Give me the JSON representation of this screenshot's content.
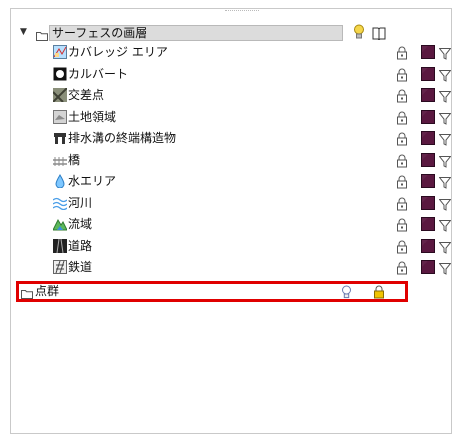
{
  "group": {
    "label": "サーフェスの画層",
    "expander_icon": "expand-triangle-icon",
    "folder_icon": "folder-icon",
    "visibility_icon": "lightbulb-on-icon",
    "book_icon": "open-book-icon"
  },
  "layers": [
    {
      "label": "カバレッジ エリア",
      "icon": "coverage-area-icon"
    },
    {
      "label": "カルバート",
      "icon": "culvert-icon"
    },
    {
      "label": "交差点",
      "icon": "intersection-icon"
    },
    {
      "label": "土地領域",
      "icon": "land-area-icon"
    },
    {
      "label": "排水溝の終端構造物",
      "icon": "drain-endpoint-icon"
    },
    {
      "label": "橋",
      "icon": "bridge-icon"
    },
    {
      "label": "水エリア",
      "icon": "water-area-icon"
    },
    {
      "label": "河川",
      "icon": "river-icon"
    },
    {
      "label": "流域",
      "icon": "watershed-icon"
    },
    {
      "label": "道路",
      "icon": "road-icon"
    },
    {
      "label": "鉄道",
      "icon": "railway-icon"
    }
  ],
  "layer_controls": {
    "lock_icon": "lock-icon",
    "color_swatch": "#5a1840",
    "filter_icon": "filter-icon"
  },
  "point_cloud": {
    "label": "点群",
    "folder_icon": "folder-icon",
    "visibility_icon": "lightbulb-off-icon",
    "lock_icon": "lock-icon",
    "highlight_color": "#e00000"
  }
}
